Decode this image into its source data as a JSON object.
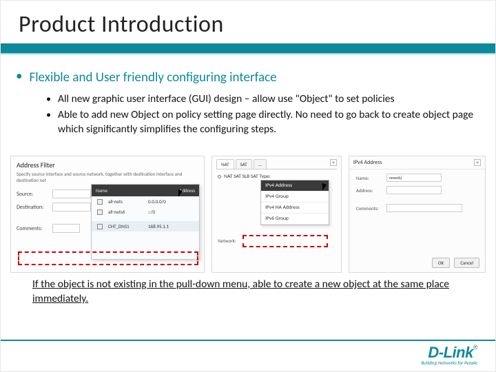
{
  "title": "Product Introduction",
  "bullet1": "Flexible and User friendly configuring interface",
  "sub_bullets": [
    "All new graphic user interface (GUI) design – allow use \"Object\" to set policies",
    "Able to add new Object on policy setting page directly. No need to go back to create object page which significantly simplifies the configuring steps."
  ],
  "caption": "If the object is not existing in the pull-down menu, able to create a new object at the same place immediately.",
  "shot1": {
    "panel_title": "Address Filter",
    "panel_sub": "Specify source interface and source network, together with destination interface and destination net",
    "labels": {
      "source": "Source:",
      "destination": "Destination:",
      "comments": "Comments:"
    },
    "popup_cols": {
      "name": "Name",
      "addr": "Address"
    },
    "popup": [
      {
        "name": "all-nets",
        "addr": "0.0.0.0/0"
      },
      {
        "name": "all-nets6",
        "addr": "::/0"
      },
      {
        "name": "CHT_DNS1",
        "addr": "168.95.1.1"
      }
    ]
  },
  "shot2": {
    "tabs": [
      "NAT",
      "SAT",
      "..."
    ],
    "setting_label": "NAT SAT SLB SAT Type:",
    "dropdown": [
      "IPv4 Address",
      "IPv4 Group",
      "IPv4 HA Address",
      "IPv6 Group"
    ],
    "lbl_network": "Network:"
  },
  "shot3": {
    "title": "IPv4 Address",
    "close": "×",
    "fields": {
      "name": "Name:",
      "address": "Address:",
      "comments": "Comments:"
    },
    "name_val": "newobj",
    "buttons": {
      "ok": "OK",
      "cancel": "Cancel"
    }
  },
  "brand": {
    "name": "D-Link",
    "reg": "®",
    "tag": "Building Networks for People"
  }
}
